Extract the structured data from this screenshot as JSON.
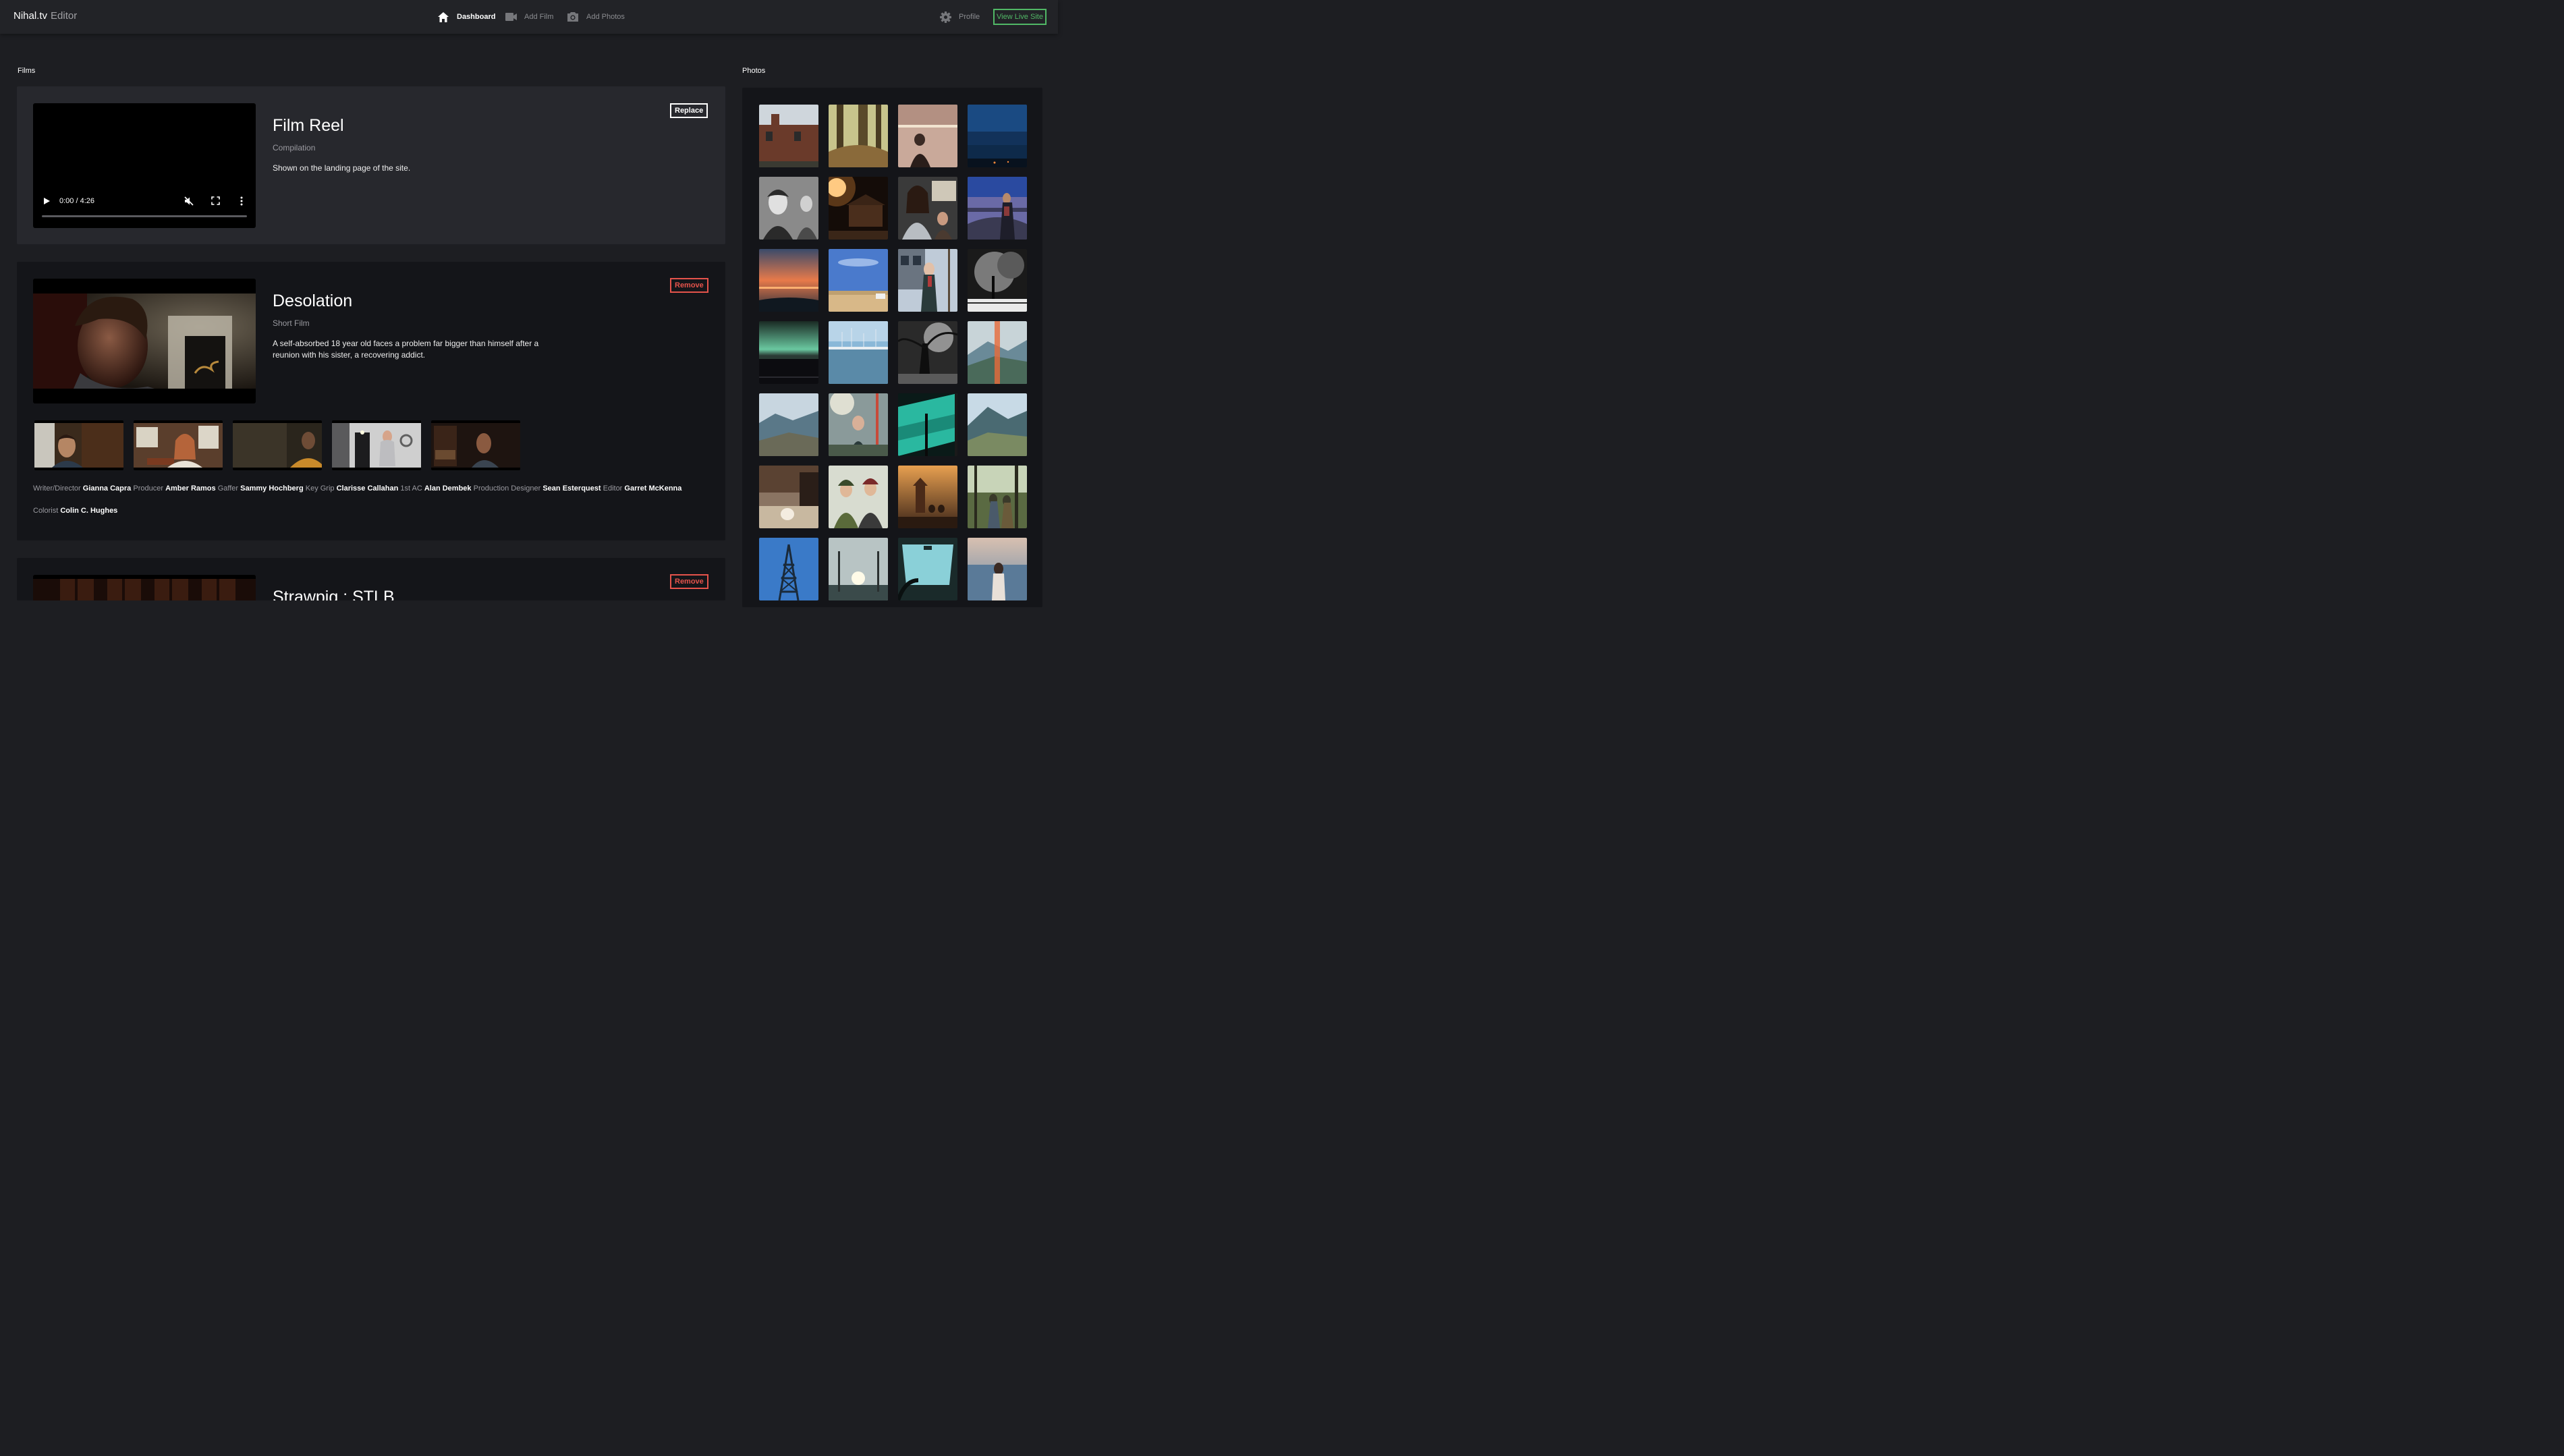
{
  "app": {
    "name": "Nihal.tv",
    "subtitle": "Editor"
  },
  "nav": {
    "dashboard": "Dashboard",
    "add_film": "Add Film",
    "add_photos": "Add Photos",
    "profile": "Profile",
    "view_live": "View Live Site"
  },
  "films_label": "Films",
  "photos_label": "Photos",
  "reel": {
    "title": "Film Reel",
    "type": "Compilation",
    "description": "Shown on the landing page of the site.",
    "time": "0:00 / 4:26",
    "progress": 0,
    "button": "Replace"
  },
  "films": [
    {
      "title": "Desolation",
      "type": "Short Film",
      "description": "A self-absorbed 18 year old faces a problem far bigger than himself after a reunion with his sister, a recovering addict.",
      "button": "Remove",
      "credits": [
        {
          "role": "Writer/Director",
          "name": "Gianna Capra"
        },
        {
          "role": "Producer",
          "name": "Amber Ramos"
        },
        {
          "role": "Gaffer",
          "name": "Sammy Hochberg"
        },
        {
          "role": "Key Grip",
          "name": "Clarisse Callahan"
        },
        {
          "role": "1st AC",
          "name": "Alan Dembek"
        },
        {
          "role": "Production Designer",
          "name": "Sean Esterquest"
        },
        {
          "role": "Editor",
          "name": "Garret McKenna"
        },
        {
          "role": "Colorist",
          "name": "Colin C. Hughes"
        }
      ]
    },
    {
      "title": "Strawpig : STLB",
      "button": "Remove"
    }
  ],
  "colors": {
    "accent_green": "#51b866",
    "remove_red": "#e5534b",
    "background": "#1d1e22"
  },
  "icons": {
    "dashboard": "home-icon",
    "add_film": "video-camera-icon",
    "add_photos": "camera-icon",
    "profile": "gear-icon"
  }
}
